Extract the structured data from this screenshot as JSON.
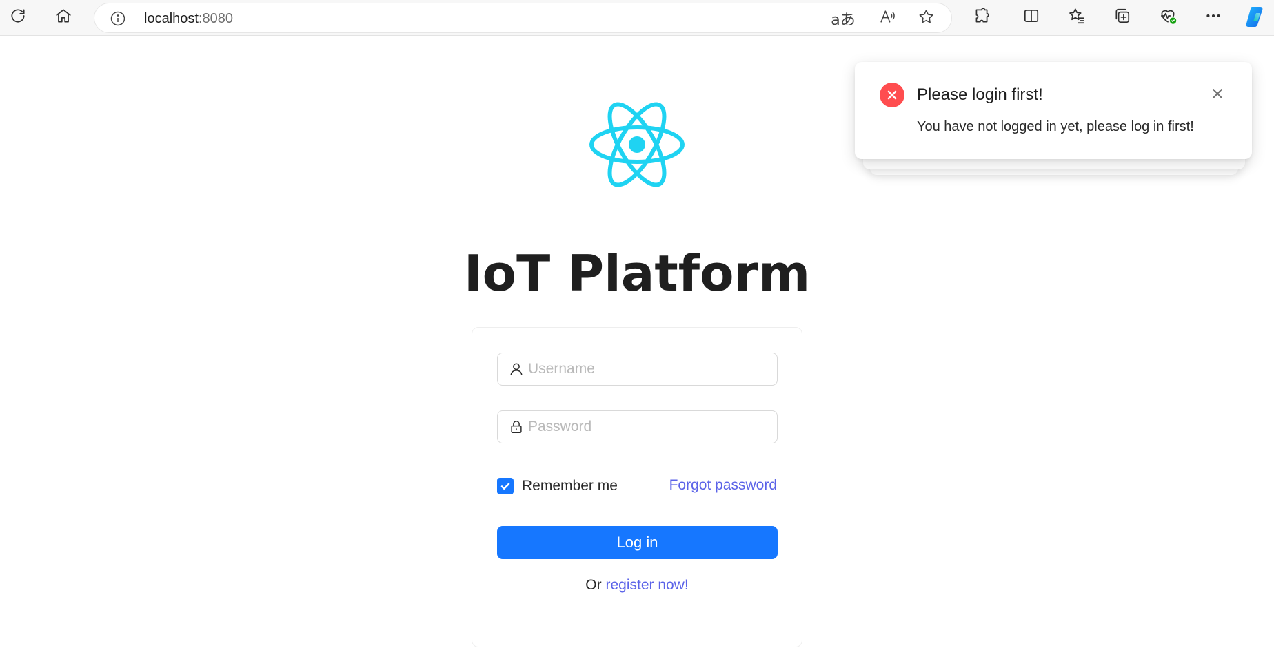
{
  "browser": {
    "url_host": "localhost",
    "url_port": ":8080",
    "icons": {
      "refresh": "refresh-icon",
      "home": "home-icon",
      "info": "site-info-icon",
      "translate": "translate-icon",
      "read_aloud": "read-aloud-icon",
      "favorite": "star-icon",
      "extensions": "extensions-icon",
      "split_screen": "split-screen-icon",
      "favorites": "favorites-icon",
      "collections": "collections-icon",
      "browser_essentials": "heartbeat-icon",
      "more": "more-icon",
      "copilot": "copilot-icon"
    }
  },
  "app": {
    "title": "IoT Platform",
    "logo": "react-atom-logo",
    "accent_color": "#1677ff",
    "link_color": "#5b63e8",
    "logo_color": "#1fd3f2"
  },
  "login_form": {
    "username_placeholder": "Username",
    "username_value": "",
    "password_placeholder": "Password",
    "password_value": "",
    "remember_label": "Remember me",
    "remember_checked": true,
    "forgot_label": "Forgot password",
    "login_label": "Log in",
    "register_prefix": "Or",
    "register_link": "register now!"
  },
  "notification": {
    "title": "Please login first!",
    "description": "You have not logged in yet, please log in first!",
    "type": "error",
    "error_color": "#ff4d4f"
  }
}
